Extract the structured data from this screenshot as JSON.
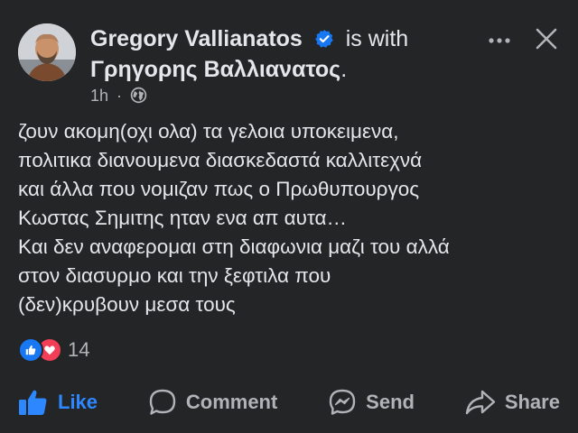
{
  "post": {
    "author": "Gregory Vallianatos",
    "is_with": "is with",
    "tagged": "Γρηγορης Βαλλιανατος",
    "tagged_suffix": ".",
    "time": "1h",
    "dot": "·",
    "audience_icon": "globe-icon",
    "verified_icon": "verified-badge-icon",
    "text": "ζουν ακομη(οχι ολα) τα γελοια υποκειμενα,\nπολιτικα διανουμενα διασκεδαστά καλλιτεχνά\nκαι άλλα που νομιζαν πως ο Πρωθυπουργος\nΚωστας Σημιτης ηταν ενα απ αυτα…\nΚαι δεν αναφερομαι στη διαφωνια μαζι του αλλά\nστον διασυρμο και την ξεφτιλα που\n(δεν)κρυβουν μεσα τους"
  },
  "reactions": {
    "count": "14",
    "icons": [
      "like-reaction-icon",
      "love-reaction-icon"
    ]
  },
  "actions": {
    "like": "Like",
    "comment": "Comment",
    "send": "Send",
    "share": "Share"
  },
  "colors": {
    "background": "#242526",
    "text": "#e4e6eb",
    "secondary": "#b0b3b8",
    "accent": "#2d88ff",
    "love": "#f33e58"
  }
}
